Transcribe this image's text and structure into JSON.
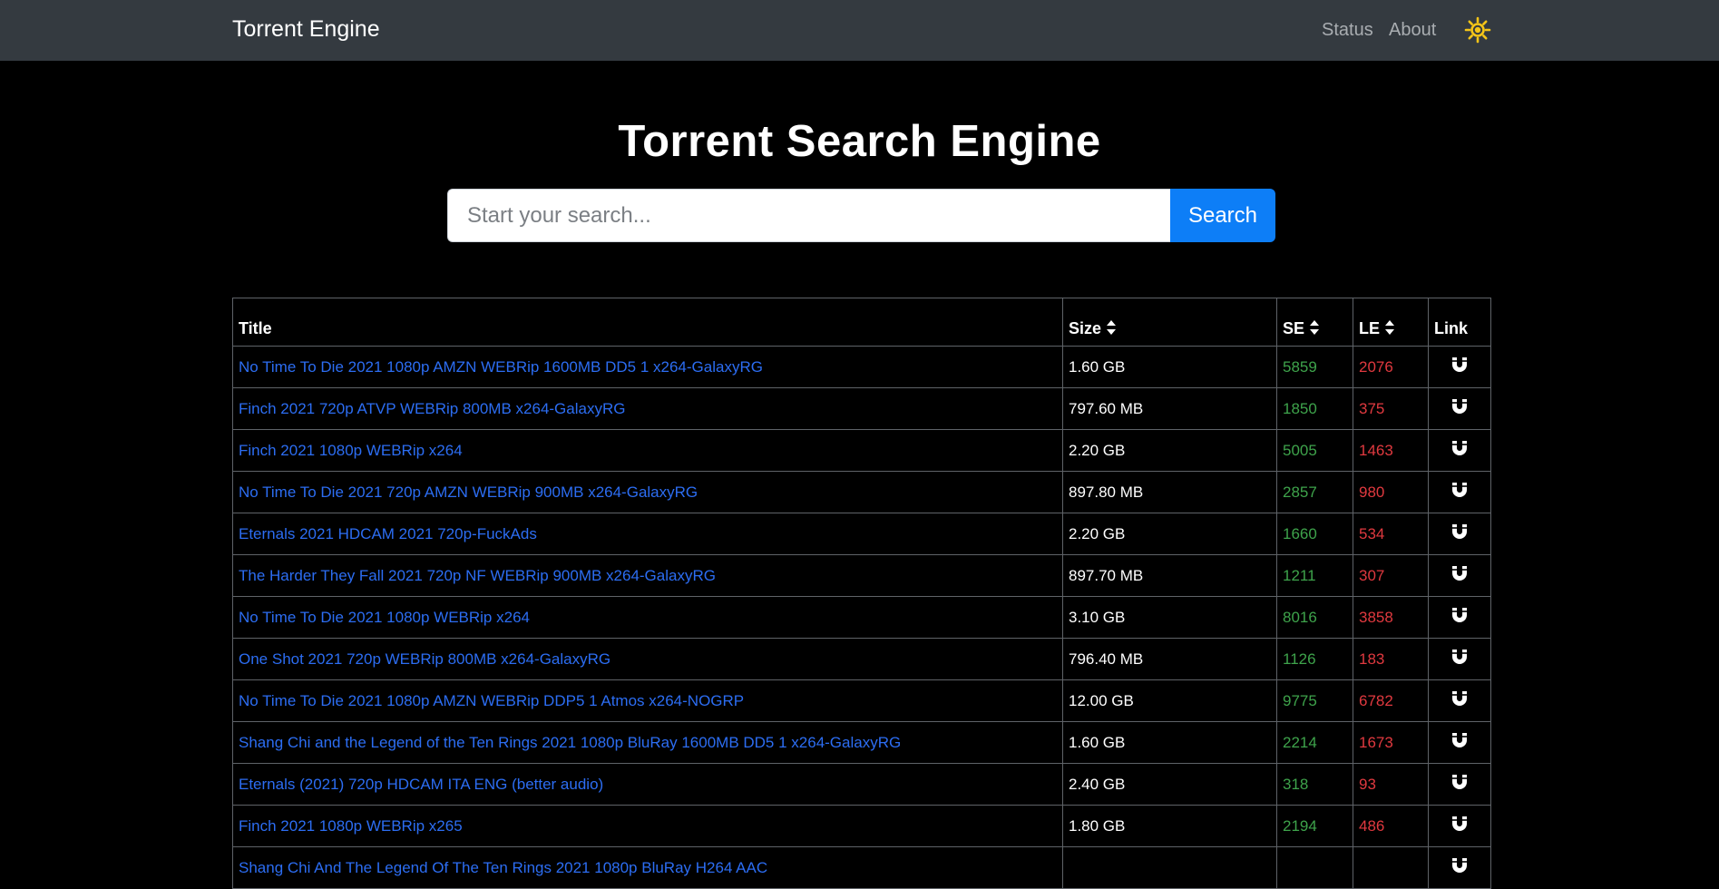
{
  "navbar": {
    "brand": "Torrent Engine",
    "links": [
      "Status",
      "About"
    ],
    "theme_icon": "sun-icon"
  },
  "hero": {
    "title": "Torrent Search Engine"
  },
  "search": {
    "placeholder": "Start your search...",
    "value": "",
    "button_label": "Search"
  },
  "table": {
    "headers": {
      "title": "Title",
      "size": "Size",
      "se": "SE",
      "le": "LE",
      "link": "Link"
    },
    "rows": [
      {
        "title": "No Time To Die 2021 1080p AMZN WEBRip 1600MB DD5 1 x264-GalaxyRG",
        "size": "1.60 GB",
        "se": "5859",
        "le": "2076"
      },
      {
        "title": "Finch 2021 720p ATVP WEBRip 800MB x264-GalaxyRG",
        "size": "797.60 MB",
        "se": "1850",
        "le": "375"
      },
      {
        "title": "Finch 2021 1080p WEBRip x264",
        "size": "2.20 GB",
        "se": "5005",
        "le": "1463"
      },
      {
        "title": "No Time To Die 2021 720p AMZN WEBRip 900MB x264-GalaxyRG",
        "size": "897.80 MB",
        "se": "2857",
        "le": "980"
      },
      {
        "title": "Eternals 2021 HDCAM 2021 720p-FuckAds",
        "size": "2.20 GB",
        "se": "1660",
        "le": "534"
      },
      {
        "title": "The Harder They Fall 2021 720p NF WEBRip 900MB x264-GalaxyRG",
        "size": "897.70 MB",
        "se": "1211",
        "le": "307"
      },
      {
        "title": "No Time To Die 2021 1080p WEBRip x264",
        "size": "3.10 GB",
        "se": "8016",
        "le": "3858"
      },
      {
        "title": "One Shot 2021 720p WEBRip 800MB x264-GalaxyRG",
        "size": "796.40 MB",
        "se": "1126",
        "le": "183"
      },
      {
        "title": "No Time To Die 2021 1080p AMZN WEBRip DDP5 1 Atmos x264-NOGRP",
        "size": "12.00 GB",
        "se": "9775",
        "le": "6782"
      },
      {
        "title": "Shang Chi and the Legend of the Ten Rings 2021 1080p BluRay 1600MB DD5 1 x264-GalaxyRG",
        "size": "1.60 GB",
        "se": "2214",
        "le": "1673"
      },
      {
        "title": "Eternals (2021) 720p HDCAM ITA ENG (better audio)",
        "size": "2.40 GB",
        "se": "318",
        "le": "93"
      },
      {
        "title": "Finch 2021 1080p WEBRip x265",
        "size": "1.80 GB",
        "se": "2194",
        "le": "486"
      },
      {
        "title": "Shang Chi And The Legend Of The Ten Rings 2021 1080p BluRay H264 AAC",
        "size": "",
        "se": "",
        "le": ""
      }
    ],
    "link_icon": "magnet-icon"
  },
  "colors": {
    "navbar_bg": "#343a40",
    "accent": "#0d7ef7",
    "link": "#2c6df2",
    "seeders": "#3ea34b",
    "leechers": "#e0393f",
    "sun": "#f5c518"
  }
}
